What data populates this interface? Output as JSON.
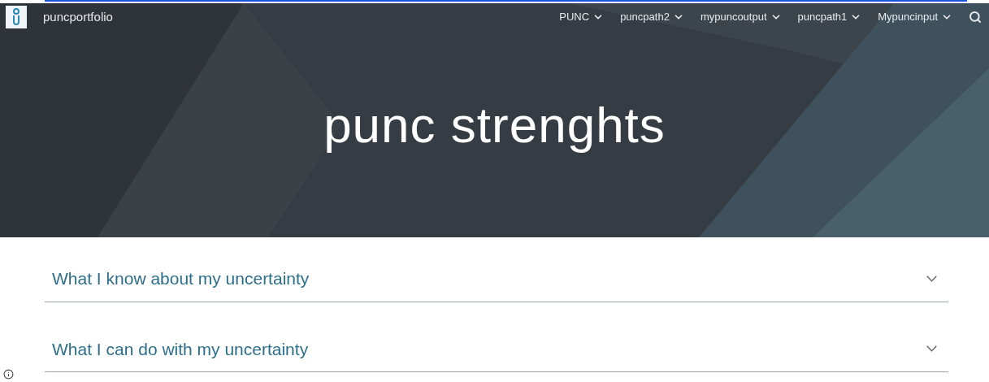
{
  "site": {
    "title": "puncportfolio"
  },
  "nav": [
    {
      "label": "PUNC"
    },
    {
      "label": "puncpath2"
    },
    {
      "label": "mypuncoutput"
    },
    {
      "label": "puncpath1"
    },
    {
      "label": "Mypuncinput"
    }
  ],
  "hero": {
    "title": "punc strenghts"
  },
  "sections": [
    {
      "title": "What I know about my uncertainty",
      "expanded": false
    },
    {
      "title": "What I can do with my uncertainty",
      "expanded": false
    }
  ]
}
